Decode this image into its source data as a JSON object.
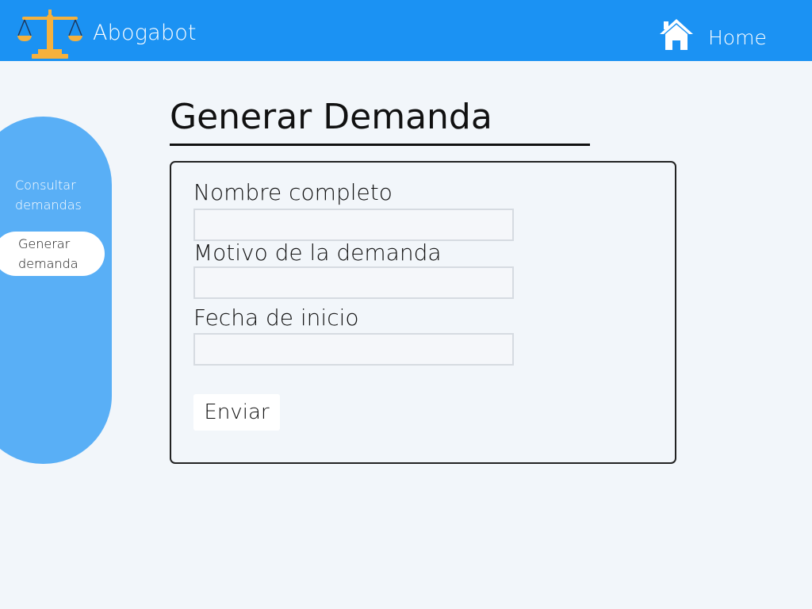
{
  "header": {
    "app_title": "Abogabot",
    "logo_icon": "scales-of-justice-icon",
    "home_icon": "home-icon",
    "home_label": "Home"
  },
  "sidebar": {
    "items": [
      {
        "label_line1": "Consultar",
        "label_line2": "demandas",
        "active": false
      },
      {
        "label_line1": "Generar",
        "label_line2": "demanda",
        "active": true
      }
    ]
  },
  "main": {
    "title": "Generar Demanda",
    "form": {
      "fields": [
        {
          "label": "Nombre completo",
          "value": "",
          "placeholder": ""
        },
        {
          "label": "Motivo de la demanda",
          "value": "",
          "placeholder": ""
        },
        {
          "label": "Fecha de inicio",
          "value": "",
          "placeholder": ""
        }
      ],
      "submit_label": "Enviar"
    }
  },
  "colors": {
    "header_bg": "#1b92f3",
    "sidebar_bg": "#59aff6",
    "page_bg": "#f2f6fa",
    "logo_gold": "#f5b13d"
  }
}
